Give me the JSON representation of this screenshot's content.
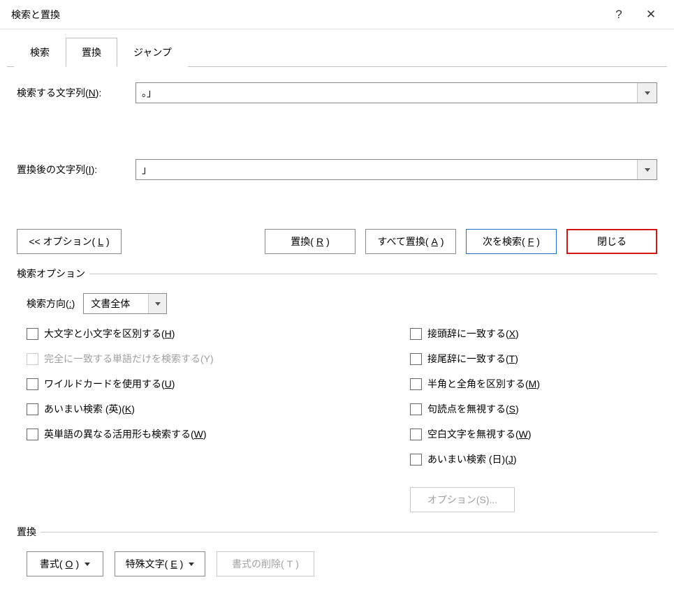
{
  "title": "検索と置換",
  "titlebar": {
    "help": "?",
    "close": "✕"
  },
  "tabs": {
    "search": "検索",
    "replace": "置換",
    "jump": "ジャンプ"
  },
  "fields": {
    "find_label_pre": "検索する文字列(",
    "find_label_mn": "N",
    "find_label_post": "):",
    "find_value": "。」",
    "replace_label_pre": "置換後の文字列(",
    "replace_label_mn": "I",
    "replace_label_post": "):",
    "replace_value": "」"
  },
  "buttons": {
    "options_pre": "<< オプション(",
    "options_mn": "L",
    "options_post": ")",
    "replace_pre": "置換(",
    "replace_mn": "R",
    "replace_post": ")",
    "replaceall_pre": "すべて置換(",
    "replaceall_mn": "A",
    "replaceall_post": ")",
    "findnext_pre": "次を検索(",
    "findnext_mn": "F",
    "findnext_post": ")",
    "close": "閉じる"
  },
  "search_options_title": "検索オプション",
  "direction": {
    "label_pre": "検索方向(",
    "label_mn": ":",
    "label_post": ")",
    "value": "文書全体"
  },
  "chk_left": [
    {
      "pre": "大文字と小文字を区別する(",
      "mn": "H",
      "post": ")",
      "disabled": false
    },
    {
      "pre": "完全に一致する単語だけを検索する(",
      "mn": "Y",
      "post": ")",
      "disabled": true,
      "no_underline": true
    },
    {
      "pre": "ワイルドカードを使用する(",
      "mn": "U",
      "post": ")",
      "disabled": false
    },
    {
      "pre": "あいまい検索 (英)(",
      "mn": "K",
      "post": ")",
      "disabled": false
    },
    {
      "pre": "英単語の異なる活用形も検索する(",
      "mn": "W",
      "post": ")",
      "disabled": false
    }
  ],
  "chk_right": [
    {
      "pre": "接頭辞に一致する(",
      "mn": "X",
      "post": ")"
    },
    {
      "pre": "接尾辞に一致する(",
      "mn": "T",
      "post": ")"
    },
    {
      "pre": "半角と全角を区別する(",
      "mn": "M",
      "post": ")"
    },
    {
      "pre": "句読点を無視する(",
      "mn": "S",
      "post": ")"
    },
    {
      "pre": "空白文字を無視する(",
      "mn": "W",
      "post": ")"
    },
    {
      "pre": "あいまい検索 (日)(",
      "mn": "J",
      "post": ")"
    }
  ],
  "options_s_btn": "オプション(S)...",
  "replace_group_title": "置換",
  "format_btn": {
    "pre": "書式(",
    "mn": "O",
    "post": ")"
  },
  "special_btn": {
    "pre": "特殊文字(",
    "mn": "E",
    "post": ")"
  },
  "noformat_btn": {
    "pre": "書式の削除(",
    "mn": "T",
    "post": ")"
  }
}
